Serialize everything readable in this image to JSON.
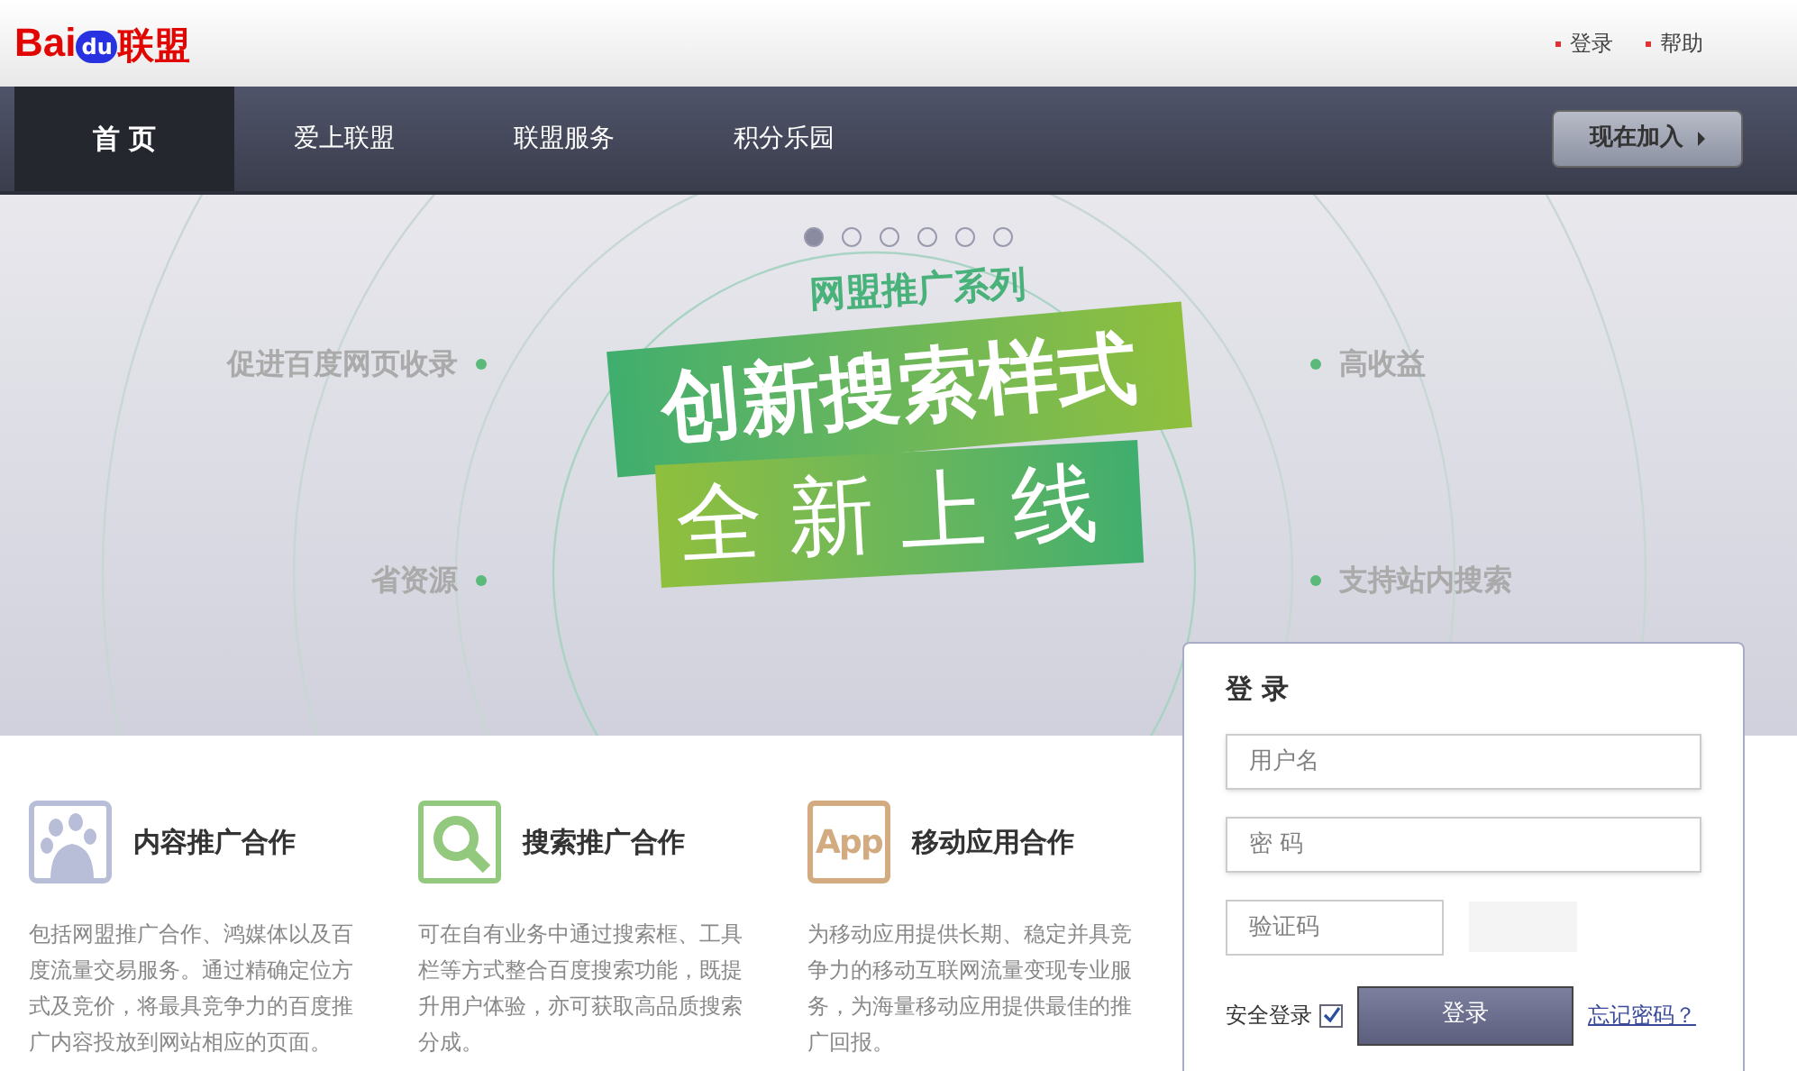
{
  "header": {
    "logo": {
      "brand": "Bai",
      "badge": "du",
      "suffix": "联盟"
    },
    "links": [
      "登录",
      "帮助"
    ]
  },
  "nav": {
    "items": [
      {
        "label": "首 页",
        "selected": true
      },
      {
        "label": "爱上联盟",
        "selected": false
      },
      {
        "label": "联盟服务",
        "selected": false
      },
      {
        "label": "积分乐园",
        "selected": false
      }
    ],
    "join_button": "现在加入"
  },
  "banner": {
    "dots": [
      {
        "selected": true
      },
      {
        "selected": false
      },
      {
        "selected": false
      },
      {
        "selected": false
      },
      {
        "selected": false
      },
      {
        "selected": false
      }
    ],
    "subtitle": "网盟推广系列",
    "title": "创新搜索样式",
    "slogan": "全新上线",
    "left_features": [
      "促进百度网页收录",
      "省资源"
    ],
    "right_features": [
      "高收益",
      "支持站内搜索"
    ]
  },
  "products": [
    {
      "kind": "paw",
      "title": "内容推广合作",
      "description": "包括网盟推广合作、鸿媒体以及百度流量交易服务。通过精确定位方式及竞价，将最具竞争力的百度推广内容投放到网站相应的页面。"
    },
    {
      "kind": "search",
      "title": "搜索推广合作",
      "description": "可在自有业务中通过搜索框、工具栏等方式整合百度搜索功能，既提升用户体验，亦可获取高品质搜索分成。"
    },
    {
      "kind": "app",
      "icon_text": "App",
      "title": "移动应用合作",
      "description": "为移动应用提供长期、稳定并具竞争力的移动互联网流量变现专业服务，为海量移动应用提供最佳的推广回报。"
    }
  ],
  "login": {
    "title": "登 录",
    "username": {
      "placeholder": "用户名"
    },
    "password": {
      "placeholder": "密 码"
    },
    "captcha": {
      "placeholder": "验证码"
    },
    "secure_login": {
      "label": "安全登录",
      "checked": true
    },
    "submit": "登录",
    "forgot": "忘记密码？"
  }
}
